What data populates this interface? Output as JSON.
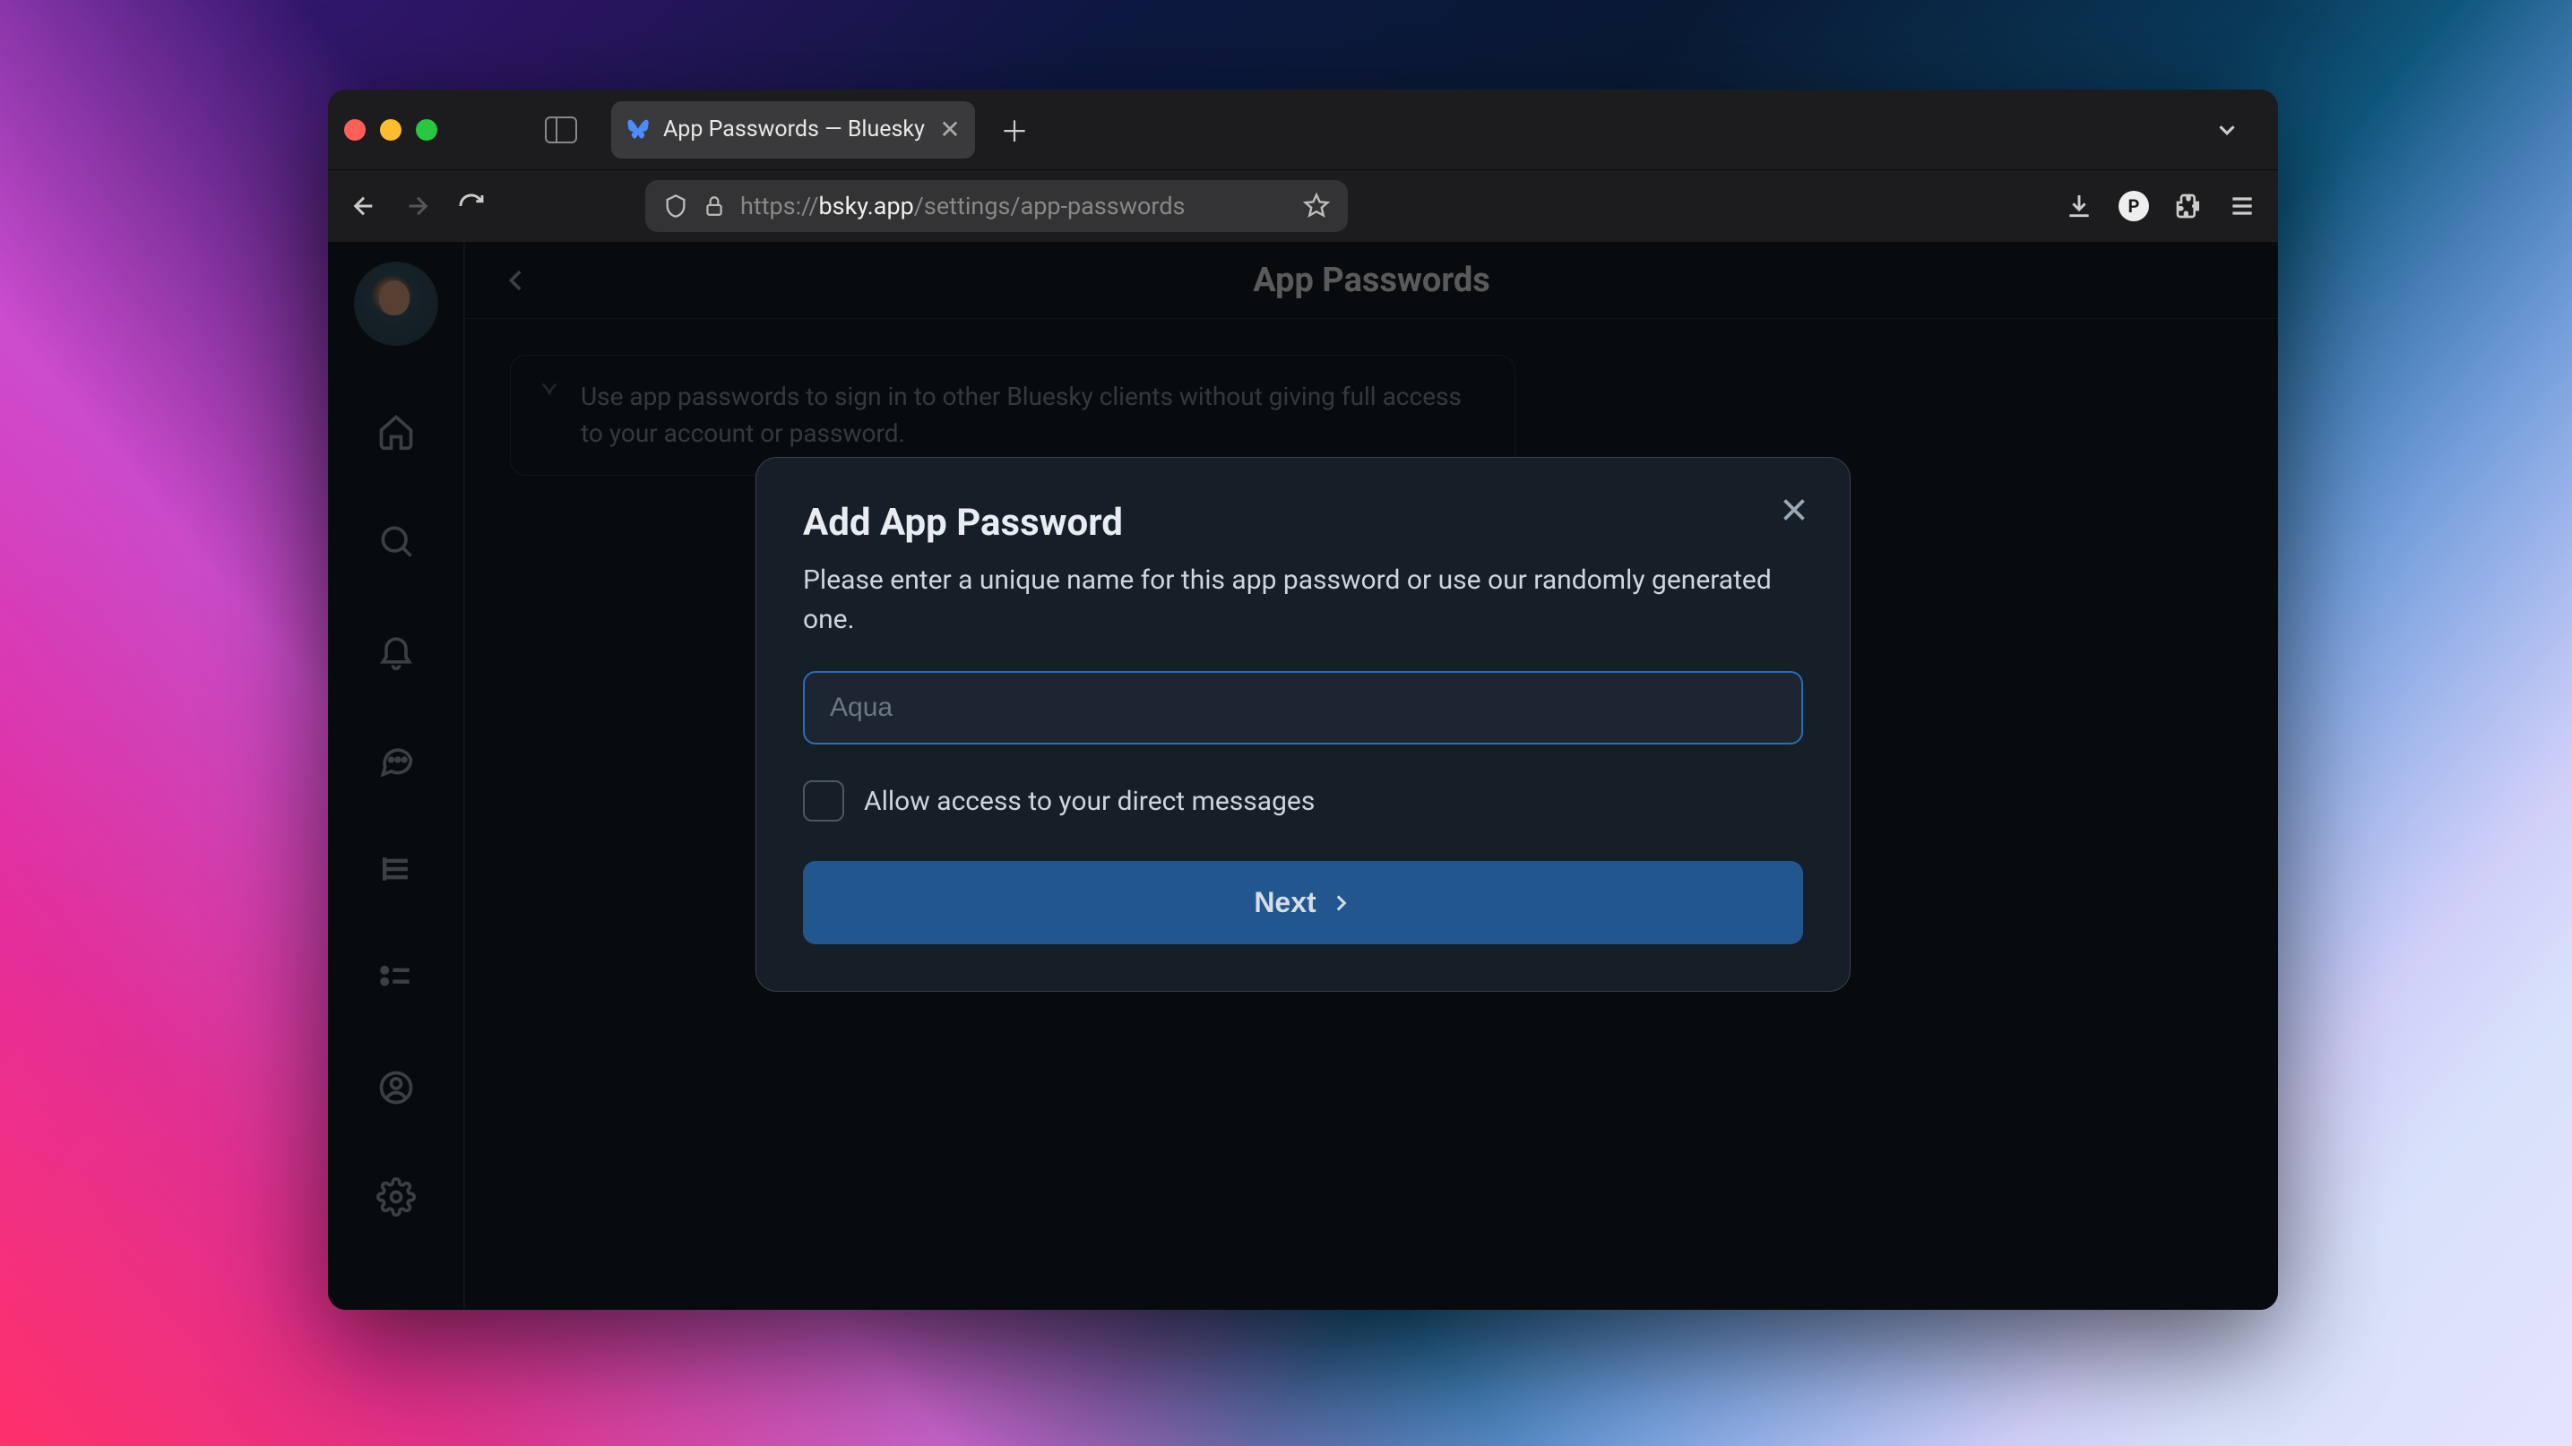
{
  "browser": {
    "tab_title": "App Passwords — Bluesky",
    "url_proto": "https://",
    "url_domain": "bsky.app",
    "url_path": "/settings/app-passwords"
  },
  "page": {
    "title": "App Passwords",
    "info_text": "Use app passwords to sign in to other Bluesky clients without giving full access to your account or password."
  },
  "modal": {
    "title": "Add App Password",
    "description": "Please enter a unique name for this app password or use our randomly generated one.",
    "input_placeholder": "Aqua",
    "input_value": "",
    "checkbox_label": "Allow access to your direct messages",
    "next_label": "Next"
  }
}
